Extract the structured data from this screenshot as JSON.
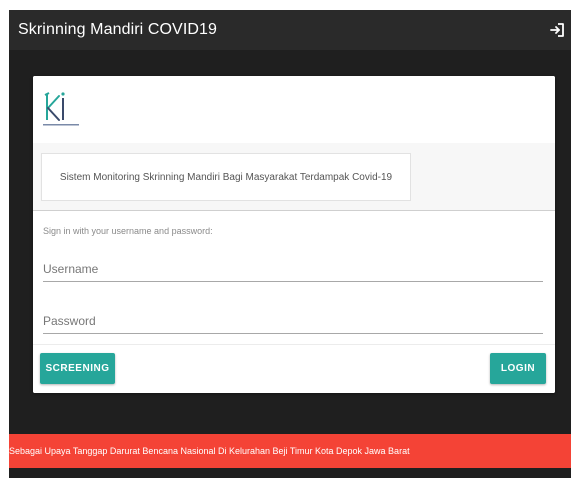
{
  "app": {
    "title": "Skrinning Mandiri COVID19"
  },
  "header": {
    "logout_icon": "logout-icon"
  },
  "card": {
    "subtitle": "Sistem Monitoring Skrinning Mandiri Bagi Masyarakat Terdampak Covid-19",
    "signin_hint": "Sign in with your username and password:",
    "username": {
      "placeholder": "Username",
      "value": ""
    },
    "password": {
      "placeholder": "Password",
      "value": ""
    },
    "screening_label": "SCREENING",
    "login_label": "LOGIN"
  },
  "footer": {
    "text": "Sebagai Upaya Tanggap Darurat Bencana Nasional Di Kelurahan Beji Timur Kota Depok Jawa Barat"
  },
  "colors": {
    "topbar": "#2a2a2a",
    "background": "#1f1f1f",
    "accent": "#26a69a",
    "footer": "#f44336",
    "logo_teal": "#26a69a",
    "logo_dark": "#3a4a6b"
  }
}
